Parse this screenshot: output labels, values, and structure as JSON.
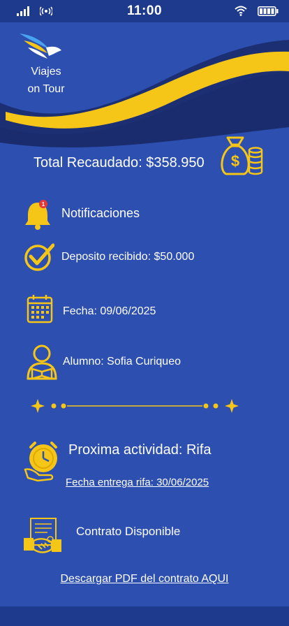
{
  "status_bar": {
    "time": "11:00"
  },
  "brand": {
    "line1": "Viajes",
    "line2": "on Tour"
  },
  "summary": {
    "total_label": "Total Recaudado: $358.950"
  },
  "notifications": {
    "title": "Notificaciones",
    "badge_count": "1",
    "deposit": "Deposito recibido: $50.000",
    "date": "Fecha: 09/06/2025",
    "student": "Alumno: Sofia Curiqueo"
  },
  "activity": {
    "title": "Proxima actividad: Rifa",
    "delivery_link": "Fecha entrega rifa:  30/06/2025"
  },
  "contract": {
    "title": "Contrato Disponible",
    "download_link": "Descargar PDF del contrato AQUI"
  },
  "colors": {
    "background": "#2c4fb0",
    "bar": "#1e3a8c",
    "accent_yellow": "#f5c518",
    "notification_red": "#e53935"
  }
}
